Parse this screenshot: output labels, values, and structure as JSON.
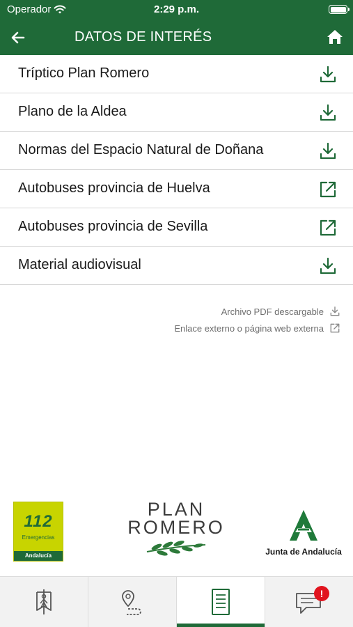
{
  "status_bar": {
    "carrier": "Operador",
    "time": "2:29 p.m."
  },
  "header": {
    "title": "DATOS DE INTERÉS",
    "back_icon": "arrow-left-icon",
    "home_icon": "home-icon"
  },
  "colors": {
    "brand_green": "#1f6a38",
    "divider": "#d7d7d7",
    "badge_red": "#e1141e",
    "logo_112_yellow": "#c8d400"
  },
  "items": [
    {
      "label": "Tríptico Plan Romero",
      "icon": "download-icon"
    },
    {
      "label": "Plano de la Aldea",
      "icon": "download-icon"
    },
    {
      "label": "Normas del Espacio Natural de Doñana",
      "icon": "download-icon"
    },
    {
      "label": "Autobuses provincia de Huelva",
      "icon": "external-link-icon"
    },
    {
      "label": "Autobuses provincia de Sevilla",
      "icon": "external-link-icon"
    },
    {
      "label": "Material audiovisual",
      "icon": "download-icon"
    }
  ],
  "legend": {
    "pdf": "Archivo PDF descargable",
    "external": "Enlace externo o página web externa"
  },
  "logos": {
    "emergency_number": "112",
    "emergency_text": "Emergencias",
    "emergency_region": "Andalucía",
    "plan_line1": "PLAN",
    "plan_line2": "ROMERO",
    "junta": "Junta de Andalucía"
  },
  "tabs": [
    {
      "icon": "pilgrim-banner-icon",
      "active": false
    },
    {
      "icon": "route-map-pin-icon",
      "active": false
    },
    {
      "icon": "document-list-icon",
      "active": true
    },
    {
      "icon": "chat-bubble-icon",
      "active": false,
      "badge": "!"
    }
  ]
}
